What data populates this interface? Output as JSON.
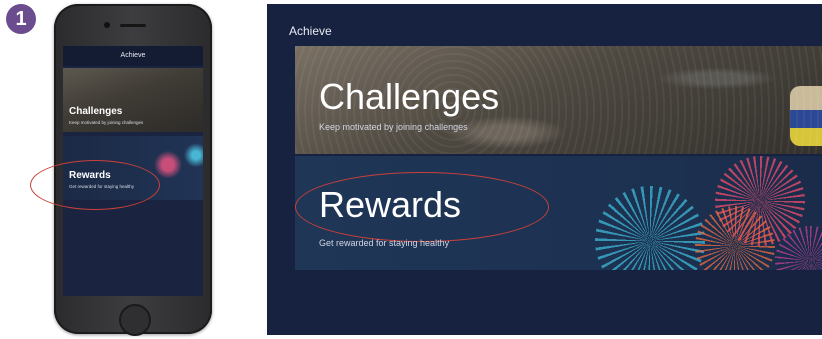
{
  "step": {
    "number": "1"
  },
  "header": {
    "title": "Achieve"
  },
  "tiles": [
    {
      "title": "Challenges",
      "subtitle": "Keep motivated by joining challenges"
    },
    {
      "title": "Rewards",
      "subtitle": "Get rewarded for staying healthy"
    }
  ],
  "colors": {
    "background": "#172240",
    "highlight_ring": "#c8403a",
    "step_badge": "#6b4c8f"
  }
}
